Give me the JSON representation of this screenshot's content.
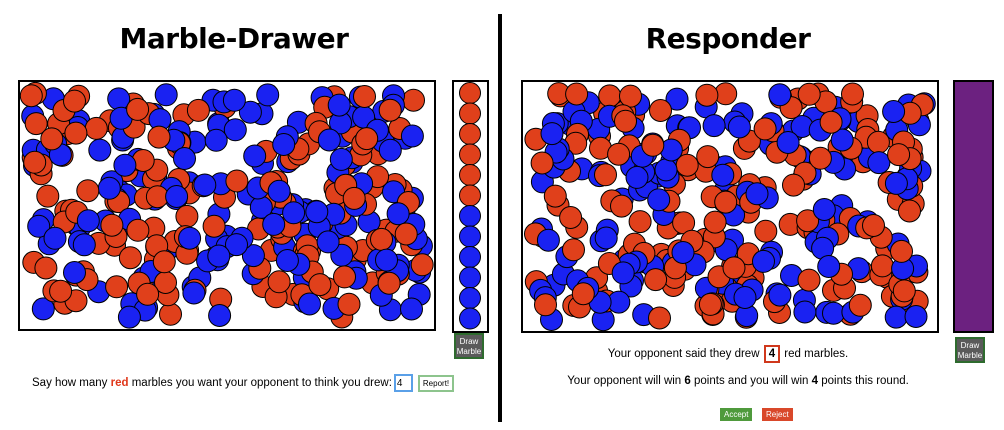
{
  "left_panel": {
    "title": "Marble-Drawer",
    "draw_button": "Draw\nMarble",
    "drawn_marbles": [
      "red",
      "red",
      "red",
      "red",
      "red",
      "red",
      "blue",
      "blue",
      "blue",
      "blue",
      "blue",
      "blue"
    ],
    "prompt": {
      "before": "Say how many ",
      "red_word": "red",
      "after": " marbles you want your opponent to think you drew:",
      "input_value": "4",
      "report_button": "Report!"
    }
  },
  "right_panel": {
    "title": "Responder",
    "draw_button": "Draw\nMarble",
    "said": {
      "before": "Your opponent said they drew ",
      "number": "4",
      "after": " red marbles."
    },
    "points": {
      "text1": "Your opponent will win ",
      "opponent_points": "6",
      "text2": " points and you will win ",
      "your_points": "4",
      "text3": " points this round."
    },
    "accept_button": "Accept",
    "reject_button": "Reject"
  },
  "colors": {
    "red_marble": "#e0401b",
    "blue_marble": "#1a22f2",
    "column_fill": "#6c2180",
    "accept": "#4f9a3c",
    "reject": "#d9482a"
  },
  "icons": {
    "marble": "circle"
  }
}
